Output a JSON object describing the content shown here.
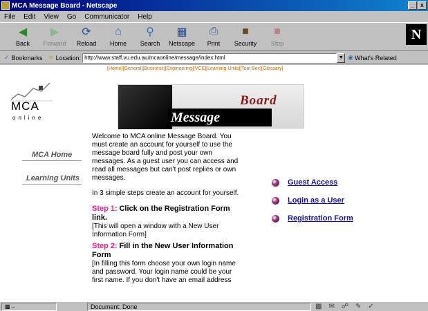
{
  "window": {
    "title": "MCA Message Board - Netscape",
    "minimize": "_",
    "close": "x"
  },
  "menu": [
    "File",
    "Edit",
    "View",
    "Go",
    "Communicator",
    "Help"
  ],
  "toolbar": {
    "buttons": [
      {
        "label": "Back",
        "icon": "back-arrow-icon"
      },
      {
        "label": "Forward",
        "icon": "forward-arrow-icon"
      },
      {
        "label": "Reload",
        "icon": "reload-icon"
      },
      {
        "label": "Home",
        "icon": "home-icon"
      },
      {
        "label": "Search",
        "icon": "search-icon"
      },
      {
        "label": "Netscape",
        "icon": "netscape-icon"
      },
      {
        "label": "Print",
        "icon": "print-icon"
      },
      {
        "label": "Security",
        "icon": "security-icon"
      },
      {
        "label": "Stop",
        "icon": "stop-icon"
      }
    ],
    "logo": "N"
  },
  "location": {
    "bookmarks_label": "Bookmarks",
    "location_label": "Location:",
    "url": "http://www.staff.vu.edu.au/mcaonline/message/index.html",
    "related": "What's Related"
  },
  "page": {
    "navlinks": "[Home][General][Business][Engineering][VCE][Learning Units][Tool Box][Glossary]",
    "logo_text": "MCA",
    "logo_sub": "online",
    "banner_message": "Message",
    "banner_board": "Board",
    "side_links": [
      "MCA Home",
      "Learning Units"
    ],
    "welcome_text": "Welcome to MCA online Message Board. You must create an account for yourself to use the message board fully and post your own messages. As a  guest user you can access and read all  messages but can't post replies or own messages.",
    "steps_intro": "In 3 simple steps create an account for yourself.",
    "step1_label": "Step 1:",
    "step1_title": "Click on the Registration Form link.",
    "step1_note": "[This will open a window with a New User Information Form]",
    "step2_label": "Step 2:",
    "step2_title": "Fill in the New User Information Form",
    "step2_note": "[In filling this form choose your own login name and password. Your login name could be your first name. If you don't have an email address",
    "actions": [
      "Guest Access",
      "Login as a User",
      "Registration Form"
    ]
  },
  "status": {
    "text": "Document: Done"
  }
}
